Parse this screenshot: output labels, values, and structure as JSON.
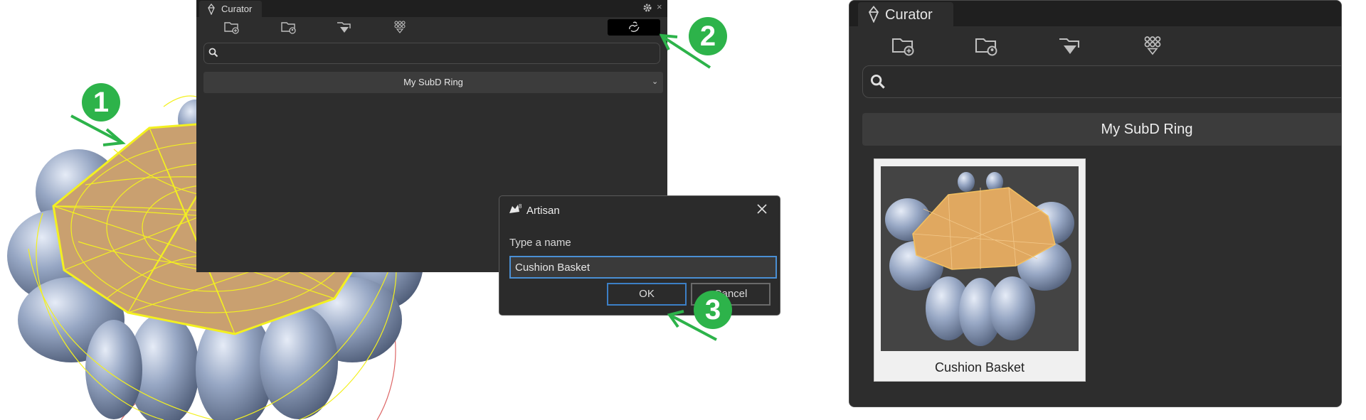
{
  "small_panel": {
    "tab_title": "Curator",
    "dropdown_value": "My SubD Ring",
    "search_placeholder": ""
  },
  "dialog": {
    "title": "Artisan",
    "prompt": "Type a name",
    "input_value": "Cushion Basket",
    "ok_label": "OK",
    "cancel_label": "Cancel"
  },
  "large_panel": {
    "tab_title": "Curator",
    "dropdown_value": "My SubD Ring",
    "search_placeholder": "",
    "items": [
      {
        "label": "Cushion Basket"
      }
    ]
  },
  "markers": [
    "1",
    "2",
    "3"
  ],
  "colors": {
    "accent_green": "#2db34a",
    "wireframe_yellow": "#f3f020",
    "gem_orange": "#e0a860",
    "metal_blue": "#8ea0c0",
    "panel_bg": "#2d2d2d",
    "focus_blue": "#4a8fd4"
  },
  "icons": [
    "curator-logo-icon",
    "add-folder-icon",
    "user-folder-icon",
    "gem-folder-icon",
    "gem-grid-icon",
    "capture-hand-icon",
    "gear-icon",
    "close-icon",
    "search-icon",
    "chevron-down-icon",
    "rhino-logo-icon"
  ]
}
